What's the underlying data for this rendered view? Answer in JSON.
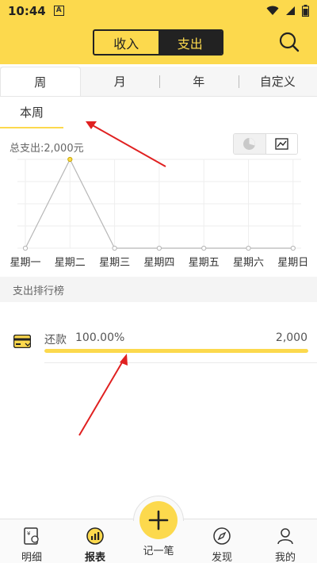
{
  "status_bar": {
    "time": "10:44",
    "notification_glyph": "A"
  },
  "header": {
    "segment": {
      "income_label": "收入",
      "expense_label": "支出",
      "selected": "支出"
    },
    "icons": {
      "search": "search-icon"
    }
  },
  "period_tabs": [
    {
      "label": "周",
      "active": true
    },
    {
      "label": "月",
      "active": false
    },
    {
      "label": "年",
      "active": false
    },
    {
      "label": "自定义",
      "active": false
    }
  ],
  "sub_tab": {
    "label": "本周"
  },
  "chart": {
    "total_label": "总支出:2,000元",
    "toggle": {
      "pie_icon": "pie-chart-icon",
      "line_icon": "line-chart-icon",
      "selected": "line"
    }
  },
  "chart_data": {
    "type": "line",
    "categories": [
      "星期一",
      "星期二",
      "星期三",
      "星期四",
      "星期五",
      "星期六",
      "星期日"
    ],
    "values": [
      0,
      2000,
      0,
      0,
      0,
      0,
      0
    ],
    "title": "总支出:2,000元",
    "xlabel": "",
    "ylabel": "",
    "ylim": [
      0,
      2000
    ],
    "grid": true,
    "colors": {
      "line": "#b7b7b7",
      "peak_point": "#fcd94d",
      "grid": "#eeeeee"
    }
  },
  "ranking": {
    "title": "支出排行榜",
    "items": [
      {
        "name": "还款",
        "percent": "100.00%",
        "fraction": 1.0,
        "amount": "2,000",
        "icon": "credit-card-icon"
      }
    ]
  },
  "bottom_nav": {
    "items": [
      {
        "label": "明细",
        "icon": "ledger-icon",
        "active": false
      },
      {
        "label": "报表",
        "icon": "report-icon",
        "active": true
      },
      {
        "label": "记一笔",
        "icon": "plus-icon",
        "active": false
      },
      {
        "label": "发现",
        "icon": "compass-icon",
        "active": false
      },
      {
        "label": "我的",
        "icon": "user-icon",
        "active": false
      }
    ]
  },
  "colors": {
    "accent": "#fcd94d",
    "dark": "#222222",
    "annotation": "#e02020"
  }
}
